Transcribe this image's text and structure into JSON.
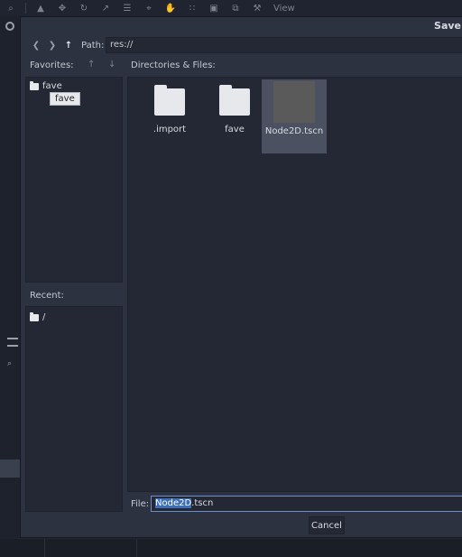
{
  "background": {
    "toolbar_view_label": "View",
    "toolbar_icons": [
      "search-icon",
      "select-icon",
      "move-icon",
      "rotate-icon",
      "scale-icon",
      "list-icon",
      "pivot-icon",
      "pan-icon",
      "snap-icon",
      "lock-icon",
      "group-icon",
      "bone-icon"
    ]
  },
  "dialog": {
    "title": "Save",
    "path": {
      "label": "Path:",
      "value": "res://"
    },
    "favorites_label": "Favorites:",
    "favorites": [
      {
        "label": "fave"
      }
    ],
    "tooltip": "fave",
    "directories_label": "Directories & Files:",
    "files": [
      {
        "name": ".import",
        "kind": "folder"
      },
      {
        "name": "fave",
        "kind": "folder"
      },
      {
        "name": "Node2D.tscn",
        "kind": "scene"
      }
    ],
    "recent_label": "Recent:",
    "recent": [
      {
        "label": "/"
      }
    ],
    "file": {
      "label": "File:",
      "selected_part": "Node2D",
      "rest_part": ".tscn"
    },
    "cancel_label": "Cancel"
  }
}
